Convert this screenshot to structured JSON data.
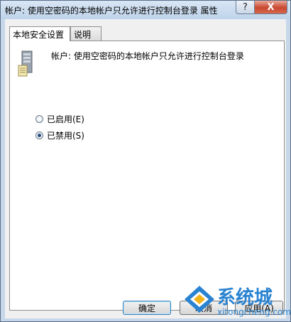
{
  "window": {
    "title": "帐户: 使用空密码的本地帐户只允许进行控制台登录 属性",
    "help_glyph": "?",
    "close_glyph": "X"
  },
  "tabs": [
    {
      "label": "本地安全设置",
      "active": true
    },
    {
      "label": "说明",
      "active": false
    }
  ],
  "policy": {
    "label": "帐户: 使用空密码的本地帐户只允许进行控制台登录",
    "icon": "server-icon"
  },
  "options": [
    {
      "label": "已启用(E)",
      "selected": false
    },
    {
      "label": "已禁用(S)",
      "selected": true
    }
  ],
  "buttons": {
    "ok": "确定",
    "cancel": "取消",
    "apply": "应用(A)"
  },
  "watermark": {
    "brand": "系统城",
    "url": "xitongcheng.com",
    "color": "#2a83d1"
  }
}
